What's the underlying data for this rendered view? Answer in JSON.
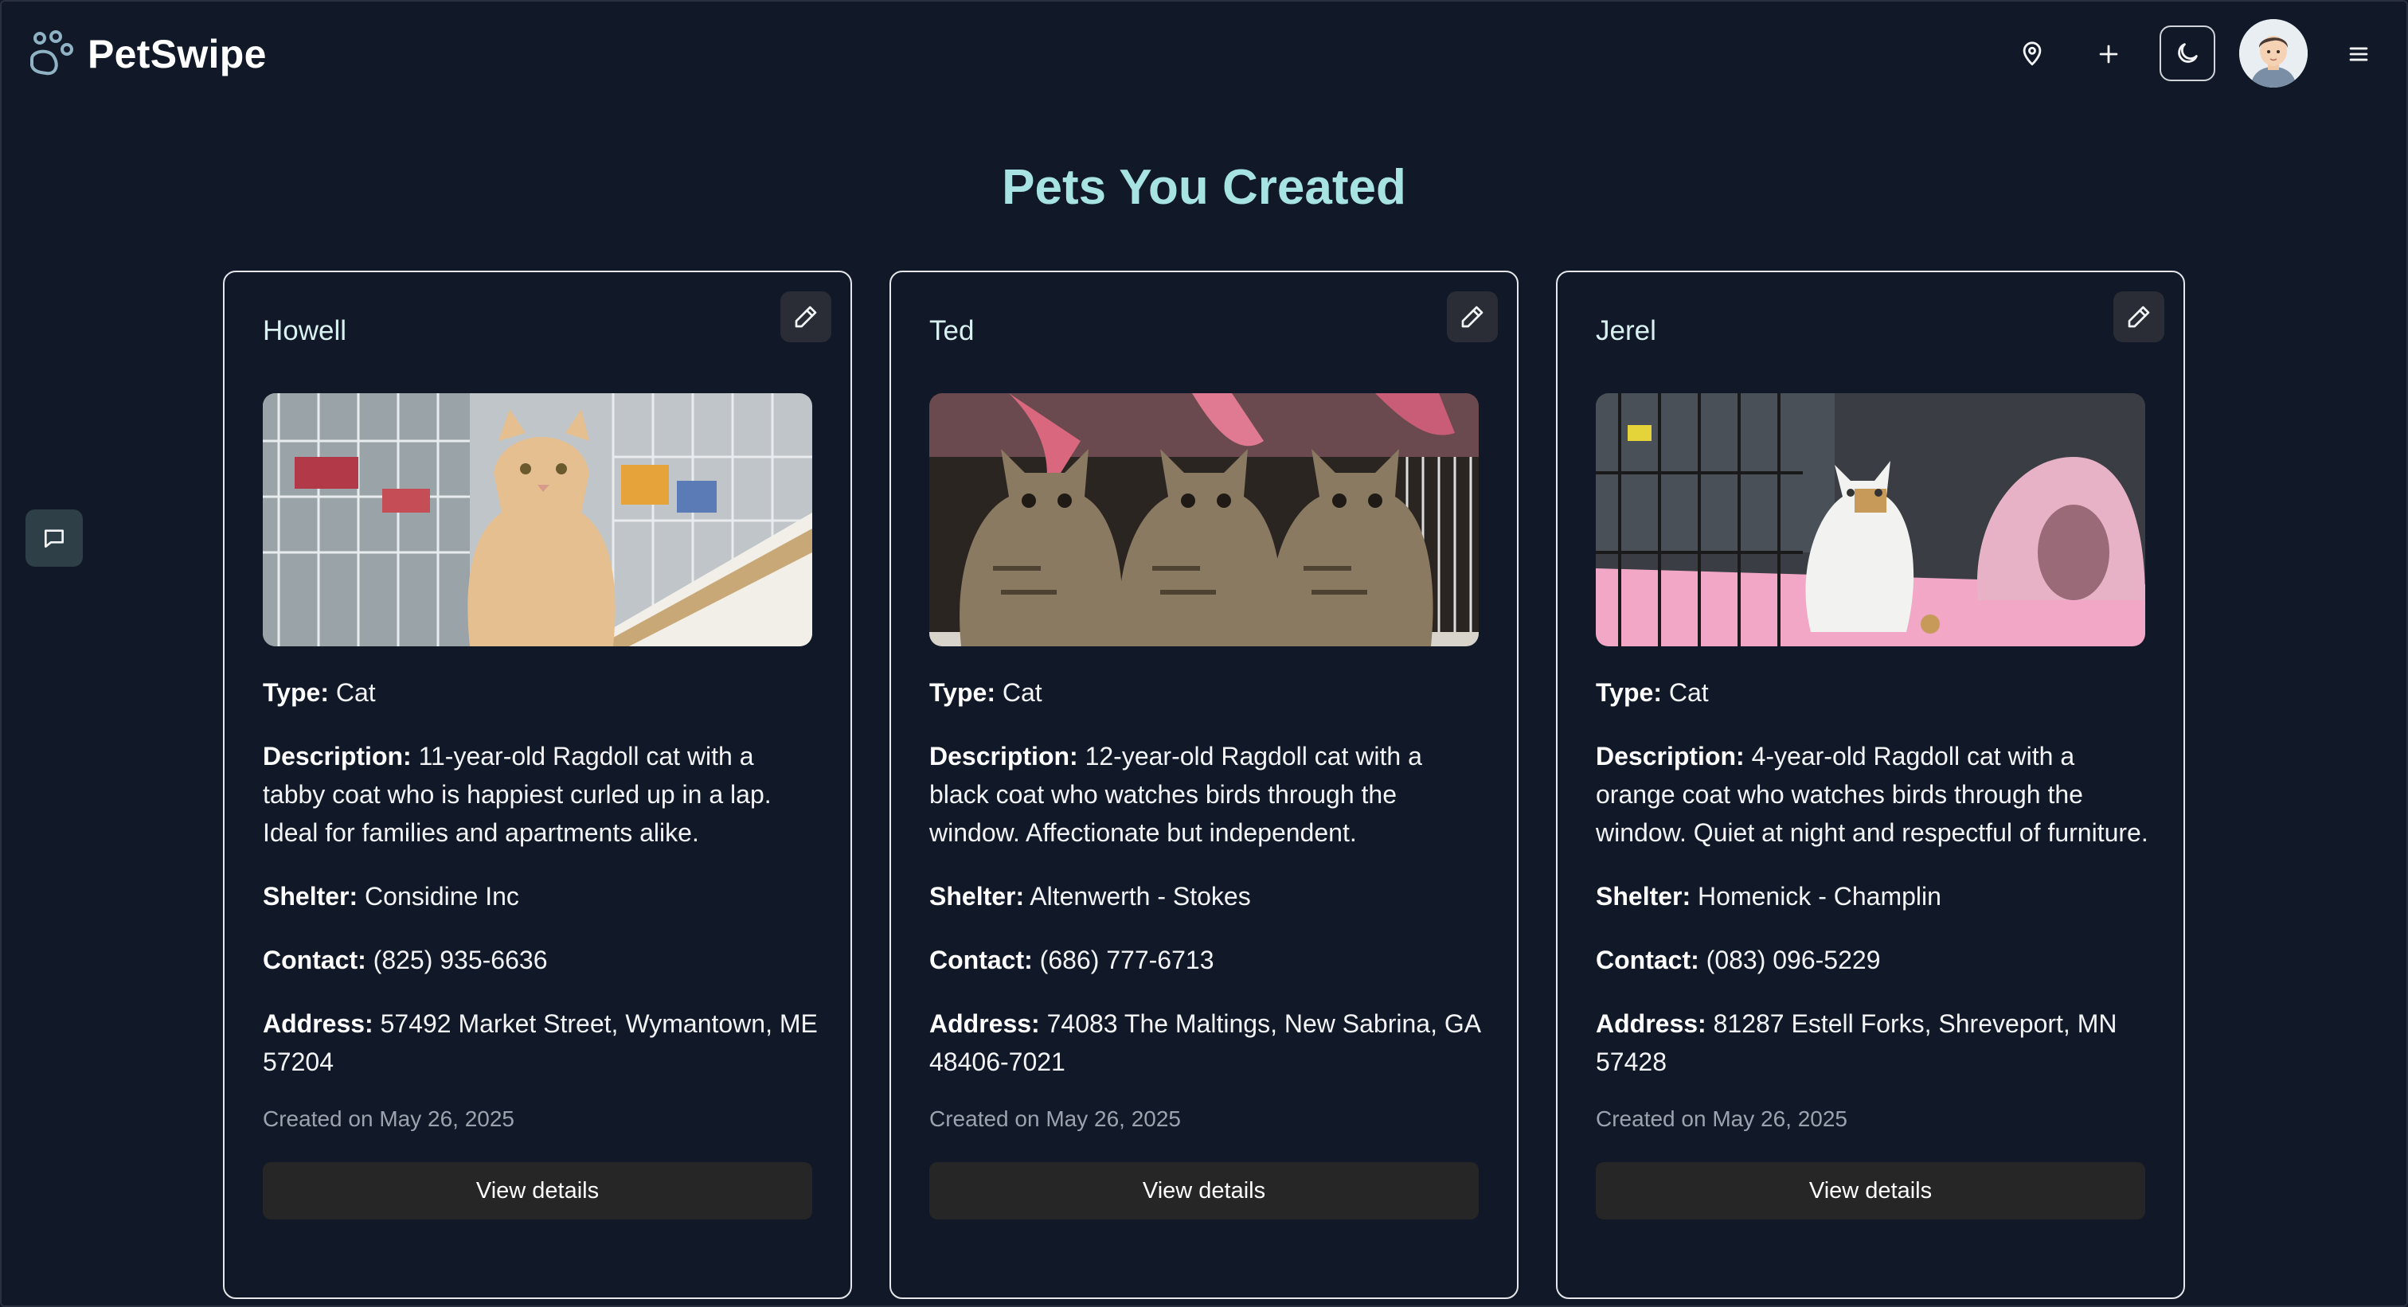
{
  "app": {
    "name": "PetSwipe"
  },
  "page": {
    "title": "Pets You Created"
  },
  "labels": {
    "type": "Type:",
    "description": "Description:",
    "shelter": "Shelter:",
    "contact": "Contact:",
    "address": "Address:",
    "view_details": "View details"
  },
  "header": {
    "icons": [
      "location-pin-icon",
      "plus-icon",
      "moon-icon",
      "avatar",
      "hamburger-menu-icon"
    ]
  },
  "colors": {
    "background": "#111827",
    "title": "#a7e3e3",
    "pet_name": "#d9f1f1",
    "button": "#262626",
    "chat_button": "#2e3f48"
  },
  "pets": [
    {
      "name": "Howell",
      "type": "Cat",
      "description": "11-year-old Ragdoll cat with a tabby coat who is happiest curled up in a lap. Ideal for families and apartments alike.",
      "shelter": "Considine Inc",
      "contact": "(825) 935-6636",
      "address": "57492 Market Street, Wymantown, ME 57204",
      "created": "Created on May 26, 2025"
    },
    {
      "name": "Ted",
      "type": "Cat",
      "description": "12-year-old Ragdoll cat with a black coat who watches birds through the window. Affectionate but independent.",
      "shelter": "Altenwerth - Stokes",
      "contact": "(686) 777-6713",
      "address": "74083 The Maltings, New Sabrina, GA 48406-7021",
      "created": "Created on May 26, 2025"
    },
    {
      "name": "Jerel",
      "type": "Cat",
      "description": "4-year-old Ragdoll cat with a orange coat who watches birds through the window. Quiet at night and respectful of furniture.",
      "shelter": "Homenick - Champlin",
      "contact": "(083) 096-5229",
      "address": "81287 Estell Forks, Shreveport, MN 57428",
      "created": "Created on May 26, 2025"
    }
  ]
}
